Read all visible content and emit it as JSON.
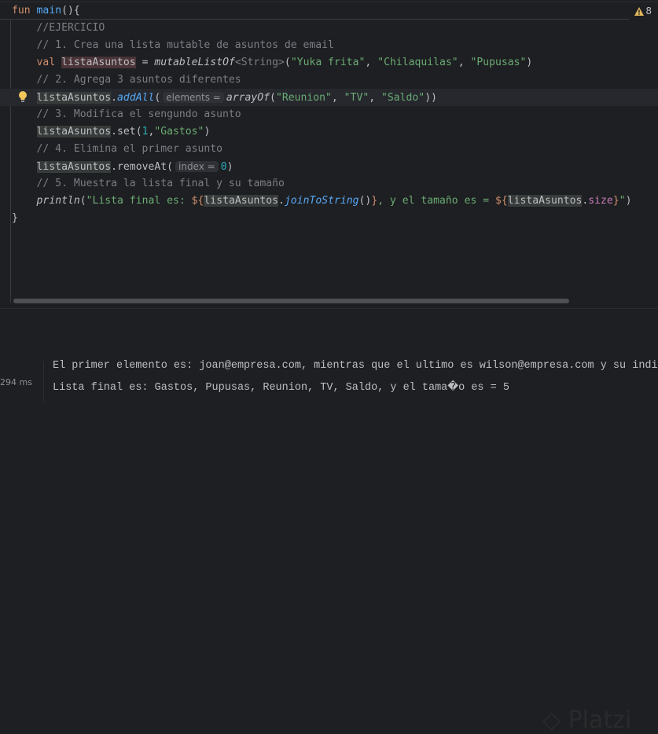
{
  "editor": {
    "warnings_count": "8",
    "lines": [
      [
        {
          "t": "fun ",
          "c": "kw"
        },
        {
          "t": "main",
          "c": "fnb2"
        },
        {
          "t": "(){",
          "c": ""
        }
      ],
      [
        {
          "t": "    //EJERCICIO",
          "c": "cm"
        }
      ],
      [
        {
          "t": "    // 1. Crea una lista mutable de asuntos de email",
          "c": "cm"
        }
      ],
      [
        {
          "t": "    ",
          "c": ""
        },
        {
          "t": "val ",
          "c": "kw"
        },
        {
          "t": "listaAsuntos",
          "c": "idw"
        },
        {
          "t": " = ",
          "c": ""
        },
        {
          "t": "mutableListOf",
          "c": "fni"
        },
        {
          "t": "<String>",
          "c": "gen"
        },
        {
          "t": "(",
          "c": ""
        },
        {
          "t": "\"Yuka frita\"",
          "c": "str"
        },
        {
          "t": ", ",
          "c": ""
        },
        {
          "t": "\"Chilaquilas\"",
          "c": "str"
        },
        {
          "t": ", ",
          "c": ""
        },
        {
          "t": "\"Pupusas\"",
          "c": "str"
        },
        {
          "t": ")",
          "c": ""
        }
      ],
      [
        {
          "t": "    // 2. Agrega 3 asuntos diferentes",
          "c": "cm"
        }
      ],
      [
        {
          "t": "    ",
          "c": ""
        },
        {
          "t": "listaAsuntos",
          "c": "id"
        },
        {
          "t": ".",
          "c": ""
        },
        {
          "t": "addAll",
          "c": "fnb"
        },
        {
          "t": "(",
          "c": ""
        },
        {
          "t": "elements =",
          "c": "hint"
        },
        {
          "t": "arrayOf",
          "c": "fni"
        },
        {
          "t": "(",
          "c": ""
        },
        {
          "t": "\"Reunion\"",
          "c": "str"
        },
        {
          "t": ", ",
          "c": ""
        },
        {
          "t": "\"TV\"",
          "c": "str"
        },
        {
          "t": ", ",
          "c": ""
        },
        {
          "t": "\"Saldo\"",
          "c": "str"
        },
        {
          "t": "))",
          "c": ""
        }
      ],
      [
        {
          "t": "    // 3. Modifica el sengundo asunto",
          "c": "cm"
        }
      ],
      [
        {
          "t": "    ",
          "c": ""
        },
        {
          "t": "listaAsuntos",
          "c": "id"
        },
        {
          "t": ".set(",
          "c": ""
        },
        {
          "t": "1",
          "c": "num"
        },
        {
          "t": ",",
          "c": ""
        },
        {
          "t": "\"Gastos\"",
          "c": "str"
        },
        {
          "t": ")",
          "c": ""
        }
      ],
      [
        {
          "t": "    // 4. Elimina el primer asunto",
          "c": "cm"
        }
      ],
      [
        {
          "t": "    ",
          "c": ""
        },
        {
          "t": "listaAsuntos",
          "c": "id"
        },
        {
          "t": ".removeAt(",
          "c": ""
        },
        {
          "t": "index =",
          "c": "hint"
        },
        {
          "t": "0",
          "c": "num"
        },
        {
          "t": ")",
          "c": ""
        }
      ],
      [
        {
          "t": "    // 5. Muestra la lista final y su tamaño",
          "c": "cm"
        }
      ],
      [
        {
          "t": "    ",
          "c": ""
        },
        {
          "t": "println",
          "c": "fni"
        },
        {
          "t": "(",
          "c": ""
        },
        {
          "t": "\"Lista final es: ",
          "c": "str"
        },
        {
          "t": "${",
          "c": "tm"
        },
        {
          "t": "listaAsuntos",
          "c": "id"
        },
        {
          "t": ".",
          "c": ""
        },
        {
          "t": "joinToString",
          "c": "fnb"
        },
        {
          "t": "()",
          "c": ""
        },
        {
          "t": "}",
          "c": "tm"
        },
        {
          "t": ", y el tamaño es = ",
          "c": "str"
        },
        {
          "t": "${",
          "c": "tm"
        },
        {
          "t": "listaAsuntos",
          "c": "id"
        },
        {
          "t": ".",
          "c": ""
        },
        {
          "t": "size",
          "c": "pur"
        },
        {
          "t": "}",
          "c": "tm"
        },
        {
          "t": "\"",
          "c": "str"
        },
        {
          "t": ")",
          "c": ""
        }
      ],
      [
        {
          "t": "}",
          "c": ""
        }
      ]
    ]
  },
  "output": {
    "time": "294 ms",
    "line1": "El primer elemento es: joan@empresa.com, mientras que el ultimo es wilson@empresa.com y su indice",
    "line2": "Lista final es: Gastos, Pupusas, Reunion, TV, Saldo, y el tama�o es = 5",
    "watermark": "Platzi"
  }
}
